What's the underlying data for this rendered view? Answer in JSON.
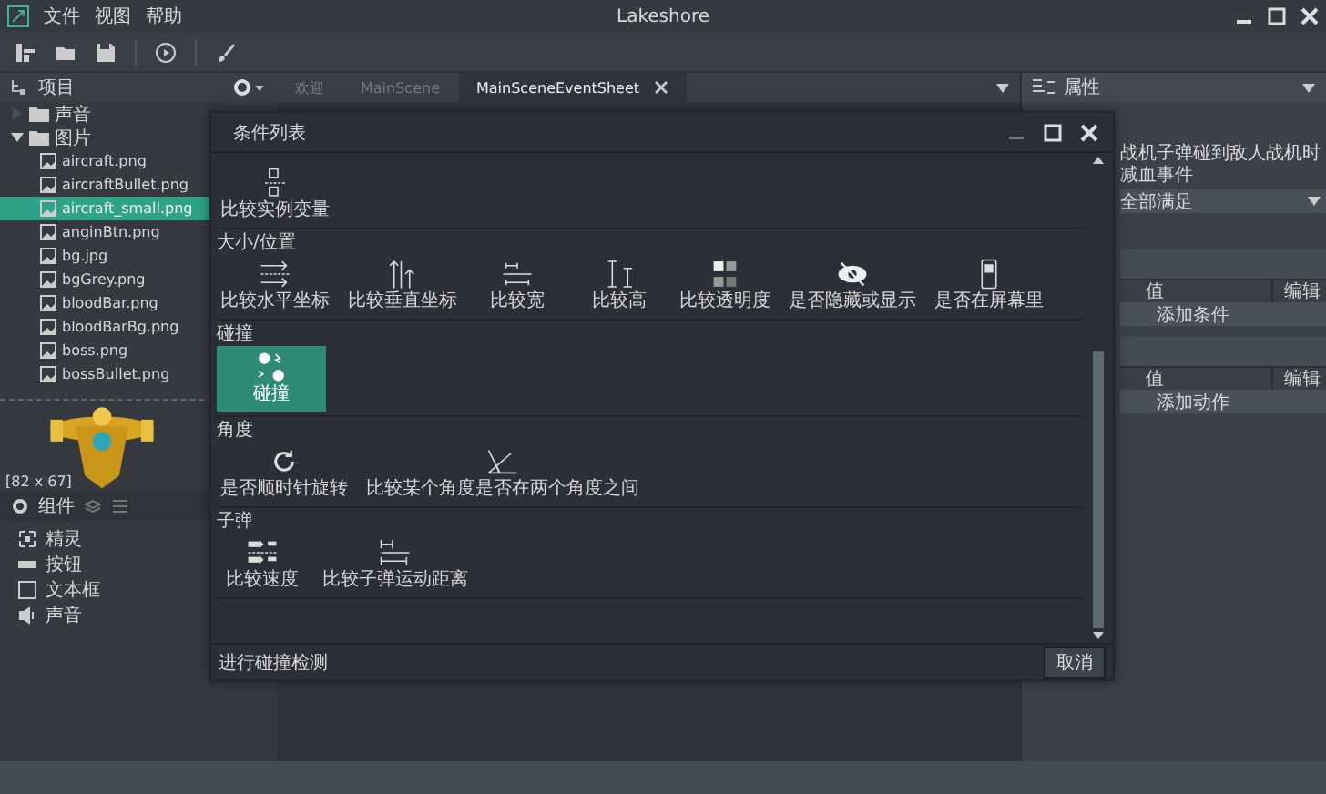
{
  "window": {
    "title": "Lakeshore",
    "menu": [
      "文件",
      "视图",
      "帮助"
    ]
  },
  "project_panel": {
    "title": "项目",
    "tree": [
      {
        "name": "声音",
        "kind": "folder",
        "expanded": false
      },
      {
        "name": "图片",
        "kind": "folder",
        "expanded": true,
        "children": [
          {
            "name": "aircraft.png",
            "selected": false
          },
          {
            "name": "aircraftBullet.png",
            "selected": false
          },
          {
            "name": "aircraft_small.png",
            "selected": true
          },
          {
            "name": "anginBtn.png",
            "selected": false
          },
          {
            "name": "bg.jpg",
            "selected": false
          },
          {
            "name": "bgGrey.png",
            "selected": false
          },
          {
            "name": "bloodBar.png",
            "selected": false
          },
          {
            "name": "bloodBarBg.png",
            "selected": false
          },
          {
            "name": "boss.png",
            "selected": false
          },
          {
            "name": "bossBullet.png",
            "selected": false
          }
        ]
      }
    ]
  },
  "preview": {
    "size": "[82 x 67]"
  },
  "component_panel": {
    "title": "组件",
    "items": [
      {
        "label": "精灵",
        "kind": "sprite"
      },
      {
        "label": "按钮",
        "kind": "button"
      },
      {
        "label": "文本框",
        "kind": "textbox"
      },
      {
        "label": "声音",
        "kind": "sound"
      }
    ]
  },
  "editor_tabs": [
    {
      "label": "欢迎",
      "selected": false
    },
    {
      "label": "MainScene",
      "selected": false
    },
    {
      "label": "MainSceneEventSheet",
      "selected": true
    }
  ],
  "properties": {
    "title": "属性",
    "event_name": "战机子弹碰到敌人战机时减血事件",
    "match_mode": "全部满足",
    "tables": [
      {
        "columns": [
          "值",
          "编辑"
        ],
        "add": "添加条件"
      },
      {
        "columns": [
          "值",
          "编辑"
        ],
        "add": "添加动作"
      }
    ]
  },
  "dialog": {
    "title": "条件列表",
    "sections": [
      {
        "items": [
          {
            "label": "比较实例变量",
            "kind": "variable",
            "selected": false
          }
        ]
      },
      {
        "title": "大小/位置",
        "items": [
          {
            "label": "比较水平坐标",
            "kind": "x",
            "selected": false
          },
          {
            "label": "比较垂直坐标",
            "kind": "y",
            "selected": false
          },
          {
            "label": "比较宽",
            "kind": "width",
            "selected": false
          },
          {
            "label": "比较高",
            "kind": "height",
            "selected": false
          },
          {
            "label": "比较透明度",
            "kind": "opacity",
            "selected": false
          },
          {
            "label": "是否隐藏或显示",
            "kind": "visibility",
            "selected": false
          },
          {
            "label": "是否在屏幕里",
            "kind": "screen",
            "selected": false
          }
        ]
      },
      {
        "title": "碰撞",
        "items": [
          {
            "label": "碰撞",
            "kind": "collision",
            "selected": true
          }
        ]
      },
      {
        "title": "角度",
        "items": [
          {
            "label": "是否顺时针旋转",
            "kind": "rotate",
            "selected": false
          },
          {
            "label": "比较某个角度是否在两个角度之间",
            "kind": "angle",
            "selected": false
          }
        ]
      },
      {
        "title": "子弹",
        "items": [
          {
            "label": "比较速度",
            "kind": "speed",
            "selected": false
          },
          {
            "label": "比较子弹运动距离",
            "kind": "distance",
            "selected": false
          }
        ]
      }
    ],
    "description": "进行碰撞检测",
    "cancel": "取消"
  }
}
